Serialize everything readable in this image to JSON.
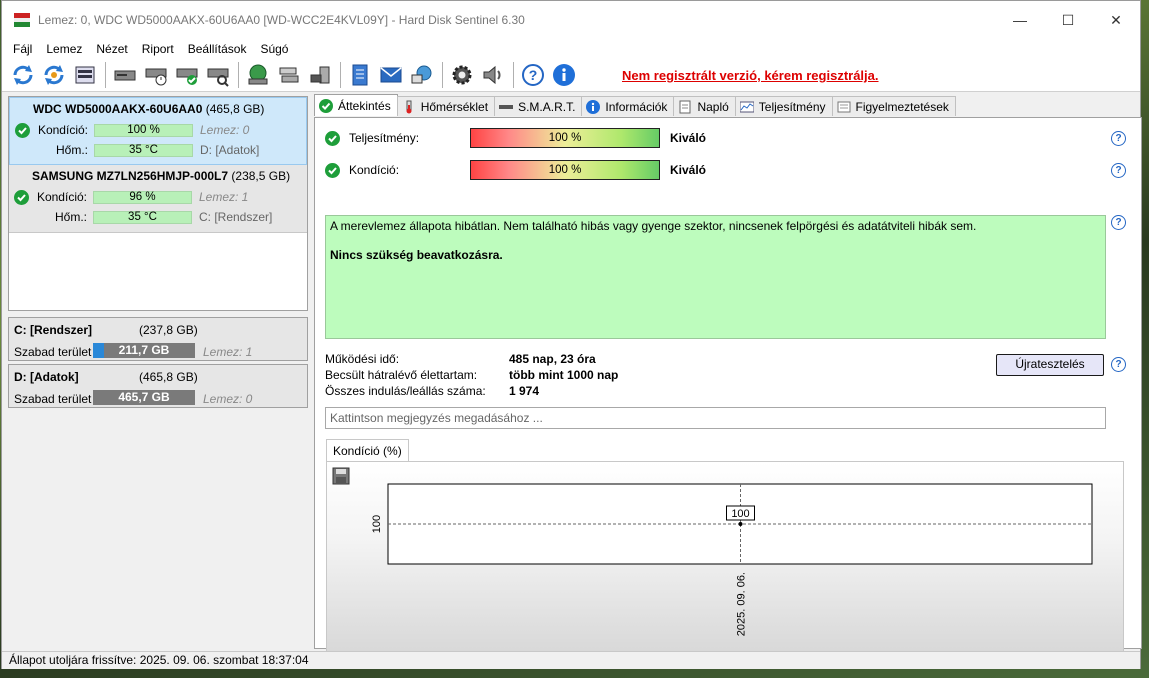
{
  "window": {
    "title": "Lemez: 0, WDC WD5000AAKX-60U6AA0 [WD-WCC2E4KVL09Y]  -  Hard Disk Sentinel 6.30",
    "minimize": "—",
    "maximize": "☐",
    "close": "✕"
  },
  "menu": [
    "Fájl",
    "Lemez",
    "Nézet",
    "Riport",
    "Beállítások",
    "Súgó"
  ],
  "toolbar": {
    "unregistered_text": "Nem regisztrált verzió, kérem regisztrálja."
  },
  "disks": [
    {
      "name": "WDC WD5000AAKX-60U6AA0",
      "size": "(465,8 GB)",
      "condition_label": "Kondíció:",
      "condition_value": "100 %",
      "condition_percent": 100,
      "disk_ref": "Lemez: 0",
      "temp_label": "Hőm.:",
      "temp_value": "35 °C",
      "drive_ref": "D: [Adatok]"
    },
    {
      "name": "SAMSUNG MZ7LN256HMJP-000L7",
      "size": "(238,5 GB)",
      "condition_label": "Kondíció:",
      "condition_value": "96 %",
      "condition_percent": 96,
      "disk_ref": "Lemez: 1",
      "temp_label": "Hőm.:",
      "temp_value": "35 °C",
      "drive_ref": "C: [Rendszer]"
    }
  ],
  "partitions": [
    {
      "name": "C: [Rendszer]",
      "size": "(237,8 GB)",
      "free_label": "Szabad terület",
      "free_value": "211,7 GB",
      "used_fraction": 0.11,
      "disk_ref": "Lemez: 1"
    },
    {
      "name": "D: [Adatok]",
      "size": "(465,8 GB)",
      "free_label": "Szabad terület",
      "free_value": "465,7 GB",
      "used_fraction": 0.0,
      "disk_ref": "Lemez: 0"
    }
  ],
  "tabs": [
    "Áttekintés",
    "Hőmérséklet",
    "S.M.A.R.T.",
    "Információk",
    "Napló",
    "Teljesítmény",
    "Figyelmeztetések"
  ],
  "overview": {
    "performance_label": "Teljesítmény:",
    "performance_value": "100 %",
    "performance_rating": "Kiváló",
    "condition_label": "Kondíció:",
    "condition_value": "100 %",
    "condition_rating": "Kiváló",
    "status_line1": "A merevlemez állapota hibátlan. Nem található hibás vagy gyenge szektor, nincsenek felpörgési és adatátviteli hibák sem.",
    "status_line2": "Nincs szükség beavatkozásra.",
    "info": [
      {
        "key": "Működési idő:",
        "value": "485 nap, 23 óra"
      },
      {
        "key": "Becsült hátralévő élettartam:",
        "value": "több mint 1000 nap"
      },
      {
        "key": "Összes indulás/leállás száma:",
        "value": "1 974"
      }
    ],
    "retest_button": "Újratesztelés",
    "note_placeholder": "Kattintson megjegyzés megadásához ...",
    "chart_tab": "Kondíció  (%)"
  },
  "chart_data": {
    "type": "line",
    "x": [
      "2025. 09. 06."
    ],
    "series": [
      {
        "values": [
          100
        ]
      }
    ],
    "ytick": "100",
    "point_label": "100"
  },
  "statusbar": {
    "text": "Állapot utoljára frissítve: 2025. 09. 06. szombat 18:37:04"
  }
}
